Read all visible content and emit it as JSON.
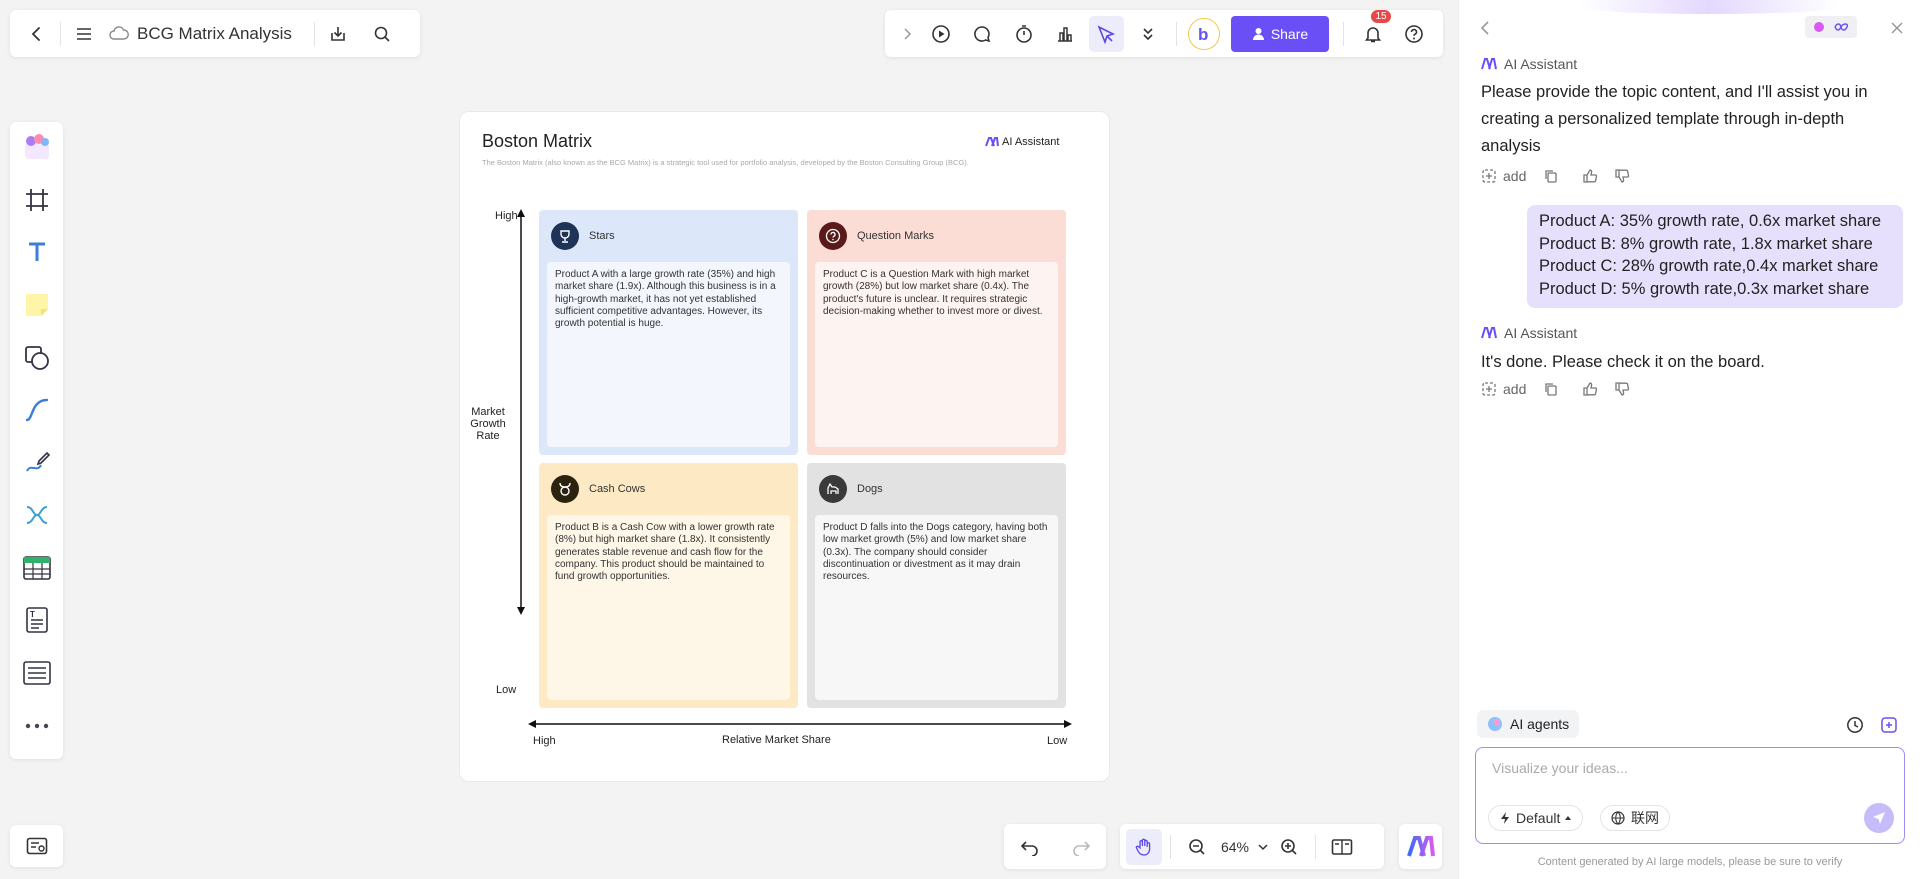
{
  "header": {
    "doc_title": "BCG Matrix Analysis",
    "share_label": "Share",
    "notification_count": "15"
  },
  "board": {
    "title": "Boston Matrix",
    "description": "The Boston Matrix (also known as the BCG Matrix) is a strategic tool used for portfolio analysis, developed by the Boston Consulting Group (BCG).",
    "ai_badge": "AI Assistant",
    "y_axis": {
      "label": "Market Growth Rate",
      "high": "High",
      "low": "Low"
    },
    "x_axis": {
      "label": "Relative Market Share",
      "high": "High",
      "low": "Low"
    },
    "quadrants": {
      "stars": {
        "title": "Stars",
        "text": "Product A with a large growth rate (35%) and high market share (1.9x). Although this business is in a high-growth market, it has not yet established sufficient competitive advantages. However, its growth potential is huge.",
        "color": "#dce7fa"
      },
      "question_marks": {
        "title": "Question Marks",
        "text": "Product C is a Question Mark with high market growth (28%) but low market share (0.4x). The product's future is unclear. It requires strategic decision-making whether to invest more or divest.",
        "color": "#fbddd6"
      },
      "cash_cows": {
        "title": "Cash Cows",
        "text": "Product B is a Cash Cow with a lower growth rate (8%) but high market share (1.8x). It consistently generates stable revenue and cash flow for the company. This product should be maintained to fund growth opportunities.",
        "color": "#fde9c4"
      },
      "dogs": {
        "title": "Dogs",
        "text": "Product D falls into the Dogs category, having both low market growth (5%) and low market share (0.3x). The company should consider discontinuation or divestment as it may drain resources.",
        "color": "#e2e2e2"
      }
    }
  },
  "zoom": {
    "level": "64%"
  },
  "ai_panel": {
    "messages": [
      {
        "author": "AI Assistant",
        "text": "Please provide the topic content, and I'll assist you in creating a personalized template through in-depth analysis",
        "action_add": "add"
      },
      {
        "author": "user",
        "lines": [
          "Product A: 35% growth rate, 0.6x market share",
          "Product B: 8% growth rate, 1.8x market share",
          "Product C: 28% growth rate,0.4x market share",
          "Product D: 5% growth rate,0.3x market share"
        ]
      },
      {
        "author": "AI Assistant",
        "text": "It's done. Please check it on the board.",
        "action_add": "add"
      }
    ],
    "agents_label": "AI agents",
    "input_placeholder": "Visualize your ideas...",
    "mode_label": "Default",
    "web_label": "联网",
    "disclaimer": "Content generated by AI large models, please be sure to verify"
  },
  "colors": {
    "accent": "#6a4ff6",
    "input_border": "#9b8cf7"
  }
}
